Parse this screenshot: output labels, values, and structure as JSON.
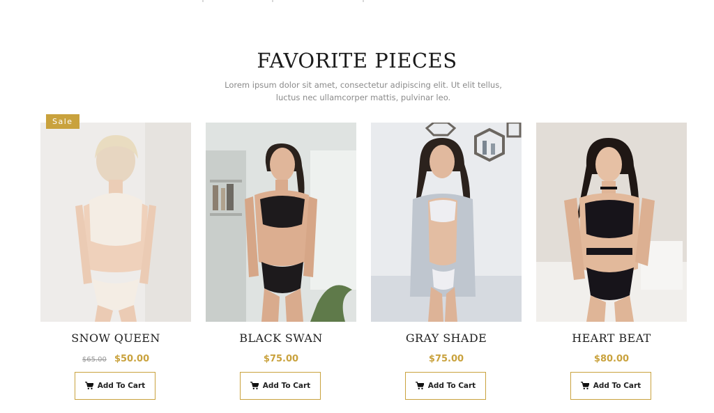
{
  "section": {
    "title": "FAVORITE PIECES",
    "subtitle": "Lorem ipsum dolor sit amet, consectetur adipiscing elit. Ut elit tellus, luctus nec ullamcorper mattis, pulvinar leo."
  },
  "colors": {
    "accent": "#c9a23d",
    "text": "#1e1e1e",
    "muted": "#8a8a8a"
  },
  "products": [
    {
      "name": "SNOW QUEEN",
      "badge": "Sale",
      "old_price": "$65.00",
      "price": "$50.00",
      "button": "Add To Cart",
      "image": "white lace lingerie model"
    },
    {
      "name": "BLACK SWAN",
      "price": "$75.00",
      "button": "Add To Cart",
      "image": "black lace lingerie model"
    },
    {
      "name": "GRAY SHADE",
      "price": "$75.00",
      "button": "Add To Cart",
      "image": "gray robe lingerie model"
    },
    {
      "name": "HEART BEAT",
      "price": "$80.00",
      "button": "Add To Cart",
      "image": "black strappy lingerie model"
    }
  ],
  "icons": {
    "cart": "cart-icon"
  }
}
